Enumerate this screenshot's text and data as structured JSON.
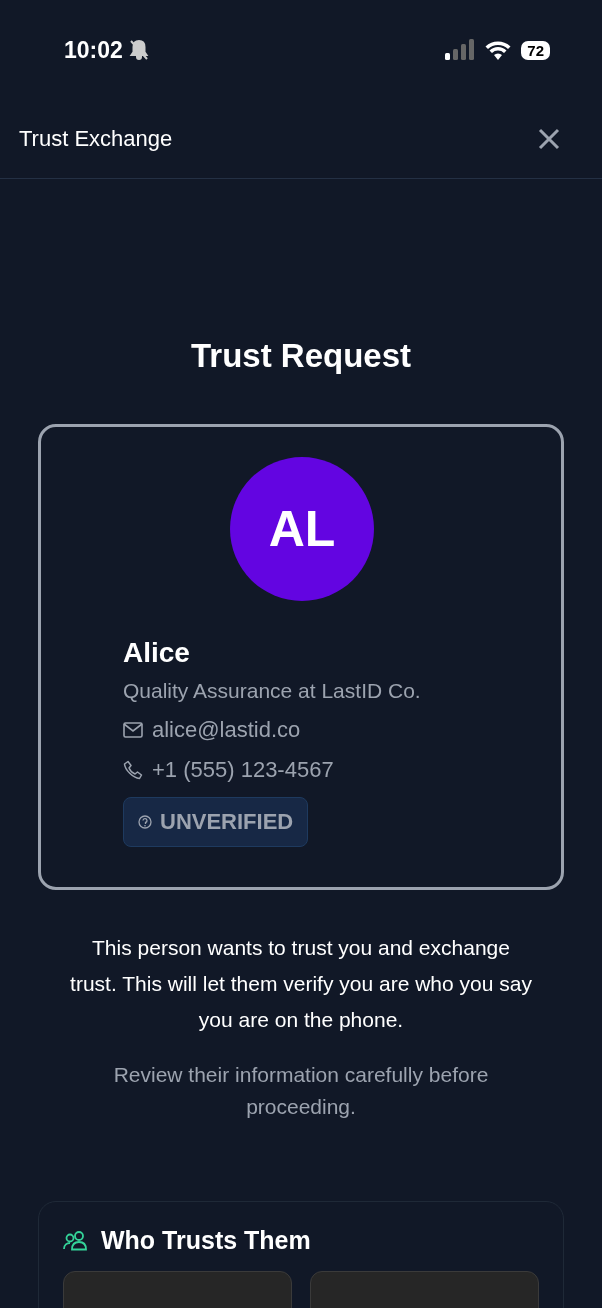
{
  "status_bar": {
    "time": "10:02",
    "battery": "72"
  },
  "header": {
    "title": "Trust Exchange"
  },
  "title": "Trust Request",
  "contact": {
    "initials": "AL",
    "name": "Alice",
    "role": "Quality Assurance at LastID Co.",
    "email": "alice@lastid.co",
    "phone": "+1 (555) 123-4567",
    "badge": "UNVERIFIED"
  },
  "message": "This person wants to trust you and exchange trust. This will let them verify you are who you say you are on the phone.",
  "note": "Review their information carefully before proceeding.",
  "who_trusts": {
    "title": "Who Trusts Them",
    "cards": [
      {
        "kind": "empty"
      },
      {
        "kind": "empty"
      }
    ]
  }
}
